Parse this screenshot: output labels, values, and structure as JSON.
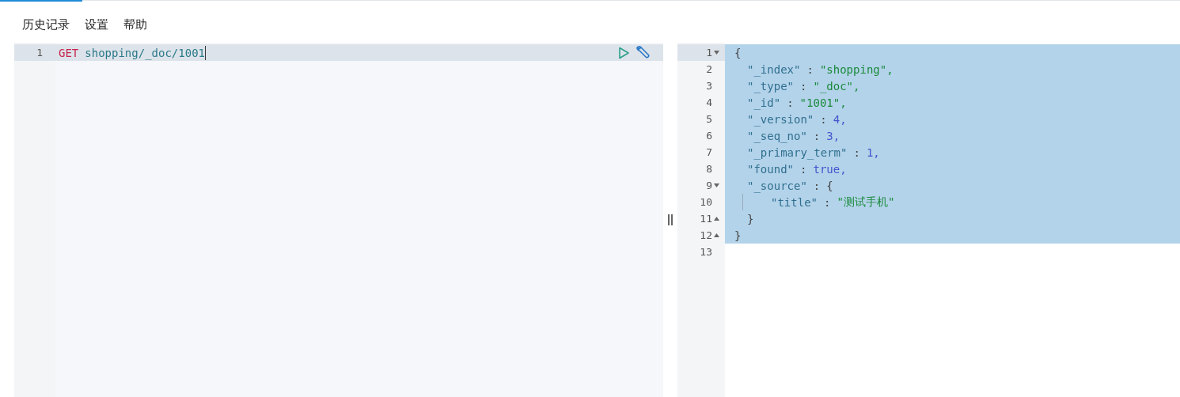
{
  "menu": [
    {
      "label": "历史记录"
    },
    {
      "label": "设置"
    },
    {
      "label": "帮助"
    }
  ],
  "request_editor": {
    "lines": [
      {
        "number": "1",
        "active": true,
        "tokens": [
          {
            "kind": "method",
            "text": "GET"
          },
          {
            "kind": "path",
            "text": "shopping/_doc/1001"
          }
        ]
      }
    ]
  },
  "response_editor": {
    "lines": [
      {
        "number": "1",
        "fold_start": true,
        "selected": true,
        "tokens": [
          {
            "kind": "punct",
            "text": "{"
          }
        ],
        "children": [
          {
            "number": "2",
            "selected": true,
            "tokens": [
              {
                "kind": "key",
                "text": "\"_index\""
              },
              {
                "kind": "punct",
                "text": ":"
              },
              {
                "kind": "string",
                "text": "\"shopping\","
              }
            ]
          },
          {
            "number": "3",
            "selected": true,
            "tokens": [
              {
                "kind": "key",
                "text": "\"_type\""
              },
              {
                "kind": "punct",
                "text": ":"
              },
              {
                "kind": "string",
                "text": "\"_doc\","
              }
            ]
          },
          {
            "number": "4",
            "selected": true,
            "tokens": [
              {
                "kind": "key",
                "text": "\"_id\""
              },
              {
                "kind": "punct",
                "text": ":"
              },
              {
                "kind": "string",
                "text": "\"1001\","
              }
            ]
          },
          {
            "number": "5",
            "selected": true,
            "tokens": [
              {
                "kind": "key",
                "text": "\"_version\""
              },
              {
                "kind": "punct",
                "text": ":"
              },
              {
                "kind": "number",
                "text": "4,"
              }
            ]
          },
          {
            "number": "6",
            "selected": true,
            "tokens": [
              {
                "kind": "key",
                "text": "\"_seq_no\""
              },
              {
                "kind": "punct",
                "text": ":"
              },
              {
                "kind": "number",
                "text": "3,"
              }
            ]
          },
          {
            "number": "7",
            "selected": true,
            "tokens": [
              {
                "kind": "key",
                "text": "\"_primary_term\""
              },
              {
                "kind": "punct",
                "text": ":"
              },
              {
                "kind": "number",
                "text": "1,"
              }
            ]
          },
          {
            "number": "8",
            "selected": true,
            "tokens": [
              {
                "kind": "key",
                "text": "\"found\""
              },
              {
                "kind": "punct",
                "text": ":"
              },
              {
                "kind": "bool",
                "text": "true,"
              }
            ]
          },
          {
            "number": "9",
            "fold_start": true,
            "selected": true,
            "tokens": [
              {
                "kind": "key",
                "text": "\"_source\""
              },
              {
                "kind": "punct",
                "text": ":"
              },
              {
                "kind": "punct",
                "text": "{"
              }
            ],
            "children": [
              {
                "number": "10",
                "selected": true,
                "tokens": [
                  {
                    "kind": "key",
                    "text": "\"title\""
                  },
                  {
                    "kind": "punct",
                    "text": ":"
                  },
                  {
                    "kind": "string",
                    "text": "\"测试手机\""
                  }
                ]
              }
            ]
          },
          {
            "number": "11",
            "fold_end": true,
            "selected": true,
            "tokens": [
              {
                "kind": "punct",
                "text": "}"
              }
            ]
          }
        ]
      },
      {
        "number": "12",
        "fold_end": true,
        "selected": true,
        "tokens": [
          {
            "kind": "punct",
            "text": "}"
          }
        ]
      },
      {
        "number": "13",
        "selected": false
      }
    ]
  }
}
